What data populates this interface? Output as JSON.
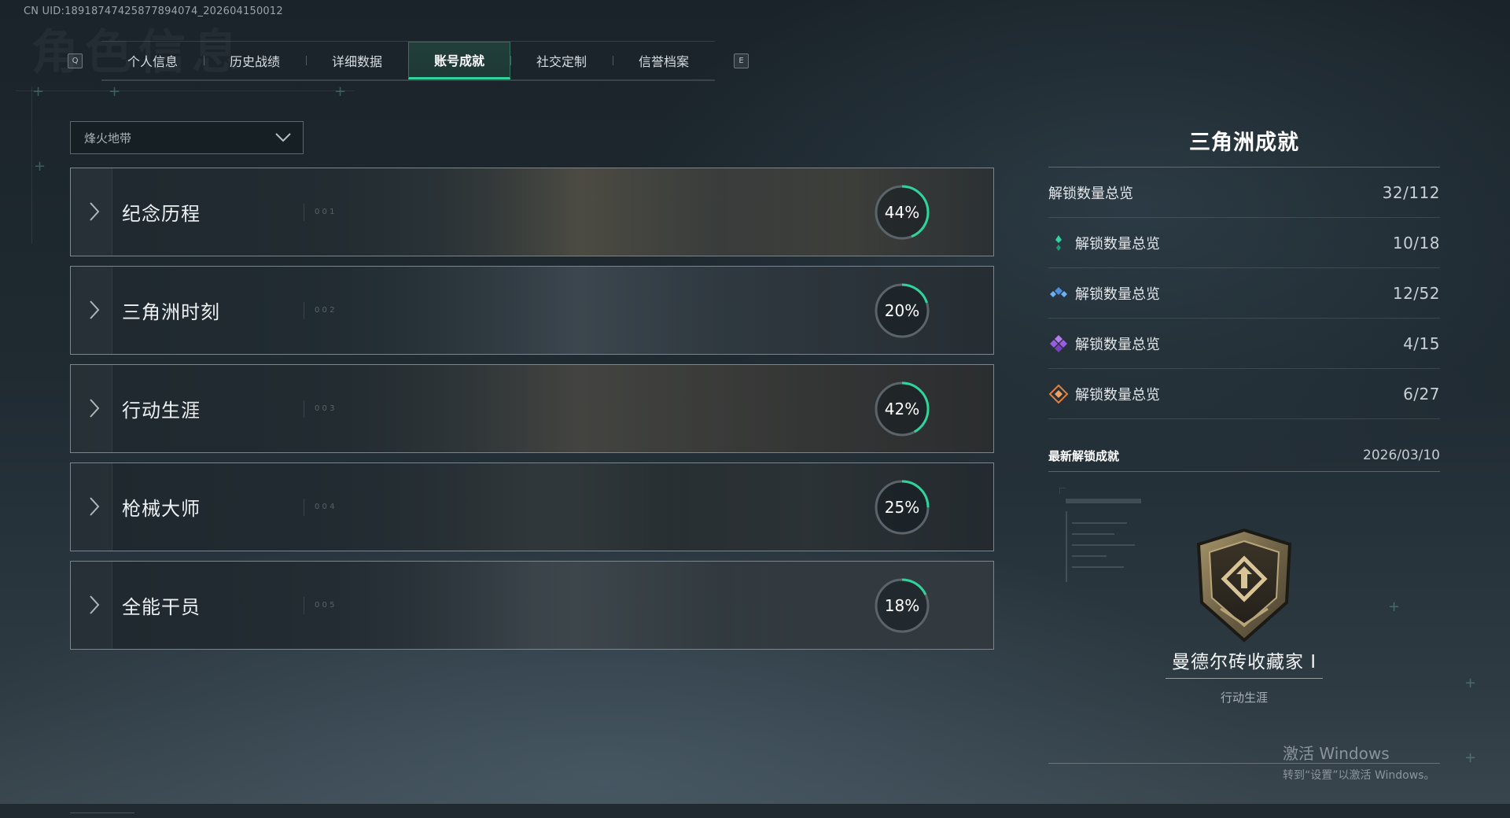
{
  "uid_text": "CN UID:18918747425877894074_202604150012",
  "tabs": {
    "key_left": "Q",
    "key_right": "E",
    "items": [
      "个人信息",
      "历史战绩",
      "详细数据",
      "账号成就",
      "社交定制",
      "信誉档案"
    ],
    "active": "账号成就"
  },
  "dropdown": {
    "selected": "烽火地带"
  },
  "categories": [
    {
      "name": "纪念历程",
      "index": "0 0 1",
      "progress": 44,
      "progress_label": "44%"
    },
    {
      "name": "三角洲时刻",
      "index": "0 0 2",
      "progress": 20,
      "progress_label": "20%"
    },
    {
      "name": "行动生涯",
      "index": "0 0 3",
      "progress": 42,
      "progress_label": "42%"
    },
    {
      "name": "枪械大师",
      "index": "0 0 4",
      "progress": 25,
      "progress_label": "25%"
    },
    {
      "name": "全能干员",
      "index": "0 0 5",
      "progress": 18,
      "progress_label": "18%"
    }
  ],
  "panel": {
    "title": "三角洲成就",
    "total": {
      "label": "解锁数量总览",
      "value": "32/112"
    },
    "tiers": [
      {
        "label": "解锁数量总览",
        "value": "10/18",
        "icon": "green-diamond-icon",
        "color": "#2fd49a"
      },
      {
        "label": "解锁数量总览",
        "value": "12/52",
        "icon": "blue-diamond-icon",
        "color": "#4a8fe0"
      },
      {
        "label": "解锁数量总览",
        "value": "4/15",
        "icon": "purple-diamond-icon",
        "color": "#9a5ce0"
      },
      {
        "label": "解锁数量总览",
        "value": "6/27",
        "icon": "orange-diamond-icon",
        "color": "#e0803a"
      }
    ],
    "latest_label": "最新解锁成就",
    "latest_date": "2026/03/10",
    "achievement": {
      "name": "曼德尔砖收藏家 I",
      "category": "行动生涯",
      "icon": "shield-badge-icon"
    }
  },
  "watermark": {
    "line1": "激活 Windows",
    "line2": "转到“设置”以激活 Windows。"
  },
  "colors": {
    "accent": "#2fd49a",
    "ring_track": "#5a646a"
  }
}
